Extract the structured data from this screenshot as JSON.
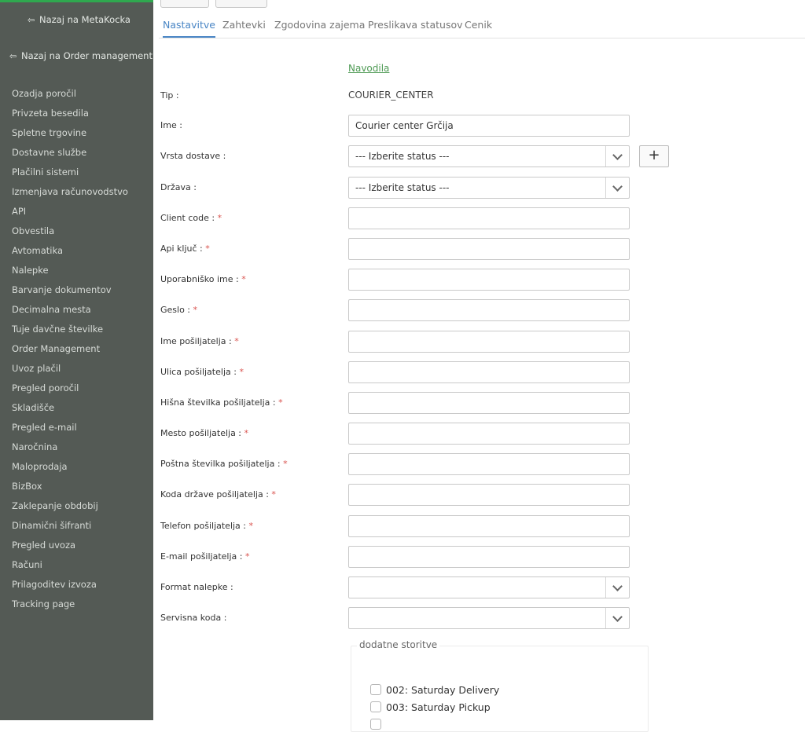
{
  "sidebar": {
    "back_links": [
      "Nazaj na MetaKocka",
      "Nazaj na Order management"
    ],
    "items": [
      "Ozadja poročil",
      "Privzeta besedila",
      "Spletne trgovine",
      "Dostavne službe",
      "Plačilni sistemi",
      "Izmenjava računovodstvo",
      "API",
      "Obvestila",
      "Avtomatika",
      "Nalepke",
      "Barvanje dokumentov",
      "Decimalna mesta",
      "Tuje davčne številke",
      "Order Management",
      "Uvoz plačil",
      "Pregled poročil",
      "Skladišče",
      "Pregled e-mail",
      "Naročnina",
      "Maloprodaja",
      "BizBox",
      "Zaklepanje obdobij",
      "Dinamični šifranti",
      "Pregled uvoza",
      "Računi",
      "Prilagoditev izvoza",
      "Tracking page"
    ]
  },
  "tabs": [
    "Nastavitve",
    "Zahtevki",
    "Zgodovina zajema",
    "Preslikava statusov",
    "Cenik"
  ],
  "form": {
    "instructions_link": "Navodila",
    "type_label": "Tip :",
    "type_value": "COURIER_CENTER",
    "name_label": "Ime :",
    "name_value": "Courier center Grčija",
    "delivery_type_label": "Vrsta dostave :",
    "delivery_type_value": "--- Izberite status ---",
    "add_button": "+",
    "country_label": "Država :",
    "country_value": "--- Izberite status ---",
    "required_mark": "*",
    "required_fields": [
      "Client code :",
      "Api ključ :",
      "Uporabniško ime :",
      "Geslo :",
      "Ime pošiljatelja :",
      "Ulica pošiljatelja :",
      "Hišna številka pošiljatelja :",
      "Mesto pošiljatelja :",
      "Poštna številka pošiljatelja :",
      "Koda države pošiljatelja :",
      "Telefon pošiljatelja :",
      "E-mail pošiljatelja :"
    ],
    "label_format_label": "Format nalepke :",
    "label_format_value": "",
    "service_code_label": "Servisna koda :",
    "service_code_value": "",
    "extra_services_legend": "dodatne storitve",
    "extra_services": [
      "002: Saturday Delivery",
      "003: Saturday Pickup"
    ]
  }
}
